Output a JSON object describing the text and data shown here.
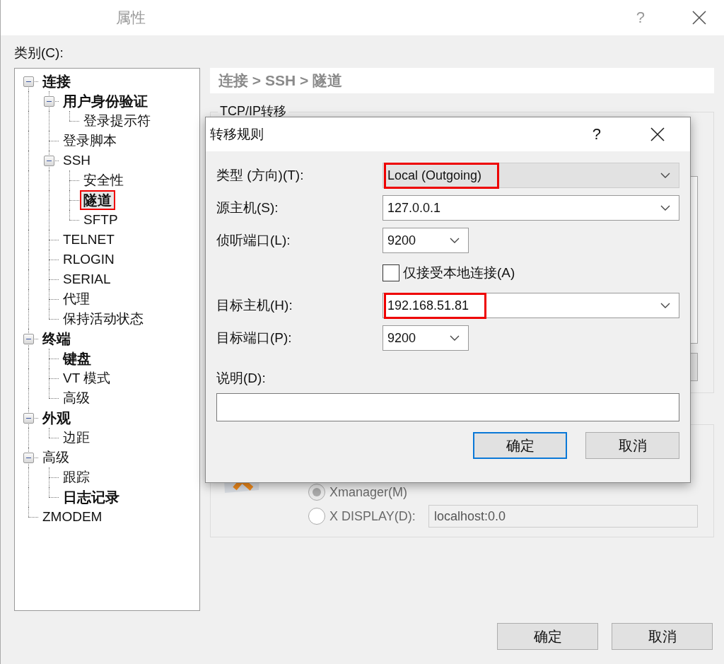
{
  "window": {
    "title": "属性",
    "help": "?"
  },
  "category_label": "类别(C):",
  "tree": [
    {
      "label": "连接",
      "bold": true,
      "selected": false,
      "highlighted": false,
      "expanded": true,
      "children": [
        {
          "label": "用户身份验证",
          "bold": true,
          "selected": false,
          "highlighted": false,
          "expanded": true,
          "children": [
            {
              "label": "登录提示符",
              "bold": false,
              "selected": false,
              "highlighted": false
            }
          ]
        },
        {
          "label": "登录脚本",
          "bold": false,
          "selected": false,
          "highlighted": false
        },
        {
          "label": "SSH",
          "bold": false,
          "selected": false,
          "highlighted": false,
          "expanded": true,
          "children": [
            {
              "label": "安全性",
              "bold": false,
              "selected": false,
              "highlighted": false
            },
            {
              "label": "隧道",
              "bold": true,
              "selected": true,
              "highlighted": true
            },
            {
              "label": "SFTP",
              "bold": false,
              "selected": false,
              "highlighted": false
            }
          ]
        },
        {
          "label": "TELNET",
          "bold": false,
          "selected": false,
          "highlighted": false
        },
        {
          "label": "RLOGIN",
          "bold": false,
          "selected": false,
          "highlighted": false
        },
        {
          "label": "SERIAL",
          "bold": false,
          "selected": false,
          "highlighted": false
        },
        {
          "label": "代理",
          "bold": false,
          "selected": false,
          "highlighted": false
        },
        {
          "label": "保持活动状态",
          "bold": false,
          "selected": false,
          "highlighted": false
        }
      ]
    },
    {
      "label": "终端",
      "bold": true,
      "selected": false,
      "highlighted": false,
      "expanded": true,
      "children": [
        {
          "label": "键盘",
          "bold": true,
          "selected": false,
          "highlighted": false
        },
        {
          "label": "VT 模式",
          "bold": false,
          "selected": false,
          "highlighted": false
        },
        {
          "label": "高级",
          "bold": false,
          "selected": false,
          "highlighted": false
        }
      ]
    },
    {
      "label": "外观",
      "bold": true,
      "selected": false,
      "highlighted": false,
      "expanded": true,
      "children": [
        {
          "label": "边距",
          "bold": false,
          "selected": false,
          "highlighted": false
        }
      ]
    },
    {
      "label": "高级",
      "bold": false,
      "selected": false,
      "highlighted": false,
      "expanded": true,
      "children": [
        {
          "label": "跟踪",
          "bold": false,
          "selected": false,
          "highlighted": false
        },
        {
          "label": "日志记录",
          "bold": true,
          "selected": false,
          "highlighted": false
        }
      ]
    },
    {
      "label": "ZMODEM",
      "bold": false,
      "selected": false,
      "highlighted": false
    }
  ],
  "breadcrumb": "连接 > SSH > 隧道",
  "tcpip_group": {
    "title": "TCP/IP转移"
  },
  "x11_group": {
    "options": [
      {
        "label": "Xmanager(M)",
        "selected": true
      },
      {
        "label": "X DISPLAY(D):",
        "selected": false,
        "value": "localhost:0.0"
      }
    ]
  },
  "buttons": [
    {
      "label": "确定",
      "default": false
    },
    {
      "label": "取消",
      "default": false
    }
  ],
  "dialog": {
    "title": "转移规则",
    "help": "?",
    "fields": [
      {
        "kind": "combo",
        "label": "类型 (方向)(T):",
        "value": "Local (Outgoing)",
        "disabled": true,
        "highlighted": true
      },
      {
        "kind": "combo",
        "label": "源主机(S):",
        "value": "127.0.0.1",
        "disabled": false,
        "highlighted": false
      },
      {
        "kind": "small-combo",
        "label": "侦听端口(L):",
        "value": "9200",
        "disabled": false,
        "highlighted": false
      },
      {
        "kind": "checkbox",
        "label": "仅接受本地连接(A)",
        "checked": false
      },
      {
        "kind": "combo",
        "label": "目标主机(H):",
        "value": "192.168.51.81",
        "disabled": false,
        "highlighted": true
      },
      {
        "kind": "small-combo",
        "label": "目标端口(P):",
        "value": "9200",
        "disabled": false,
        "highlighted": false
      }
    ],
    "description_label": "说明(D):",
    "buttons": [
      {
        "label": "确定",
        "default": true
      },
      {
        "label": "取消",
        "default": false
      }
    ]
  }
}
